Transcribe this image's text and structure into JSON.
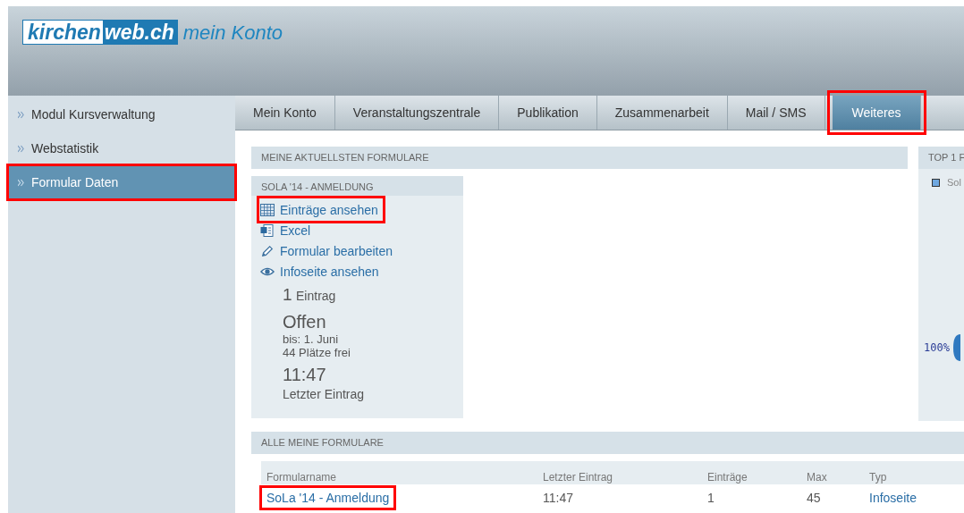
{
  "logo": {
    "part1": "kirchen",
    "part2": "web.ch",
    "subtitle": "mein Konto"
  },
  "sidebar": {
    "items": [
      {
        "label": "Modul Kursverwaltung",
        "selected": false,
        "highlighted": false
      },
      {
        "label": "Webstatistik",
        "selected": false,
        "highlighted": false
      },
      {
        "label": "Formular Daten",
        "selected": true,
        "highlighted": true
      }
    ]
  },
  "tabs": [
    {
      "label": "Mein Konto",
      "selected": false,
      "highlighted": false
    },
    {
      "label": "Veranstaltungszentrale",
      "selected": false,
      "highlighted": false
    },
    {
      "label": "Publikation",
      "selected": false,
      "highlighted": false
    },
    {
      "label": "Zusammenarbeit",
      "selected": false,
      "highlighted": false
    },
    {
      "label": "Mail / SMS",
      "selected": false,
      "highlighted": false
    },
    {
      "label": "Weiteres",
      "selected": true,
      "highlighted": true
    }
  ],
  "recent": {
    "title": "MEINE AKTUELLSTEN FORMULARE",
    "card": {
      "title": "SOLA '14 - ANMELDUNG",
      "actions": [
        {
          "kind": "table",
          "label": "Einträge ansehen",
          "highlighted": true
        },
        {
          "kind": "excel",
          "label": "Excel",
          "highlighted": false
        },
        {
          "kind": "edit",
          "label": "Formular bearbeiten",
          "highlighted": false
        },
        {
          "kind": "view",
          "label": "Infoseite ansehen",
          "highlighted": false
        }
      ],
      "count": "1",
      "count_label": "Eintrag",
      "status": "Offen",
      "until": "bis: 1. Juni",
      "places": "44 Plätze frei",
      "last_time": "11:47",
      "last_label": "Letzter Eintrag"
    }
  },
  "top": {
    "title": "TOP 1 F",
    "legend": [
      {
        "label": "Sol",
        "color": "#6fa8e0"
      }
    ],
    "percent_label": "100%"
  },
  "all": {
    "title": "ALLE MEINE FORMULARE",
    "columns": [
      "Formularname",
      "Letzter Eintrag",
      "Einträge",
      "Max",
      "Typ"
    ],
    "rows": [
      {
        "name": "SoLa '14 - Anmeldung",
        "highlighted": true,
        "last": "11:47",
        "entries": "1",
        "max": "45",
        "type": "Infoseite"
      }
    ]
  }
}
